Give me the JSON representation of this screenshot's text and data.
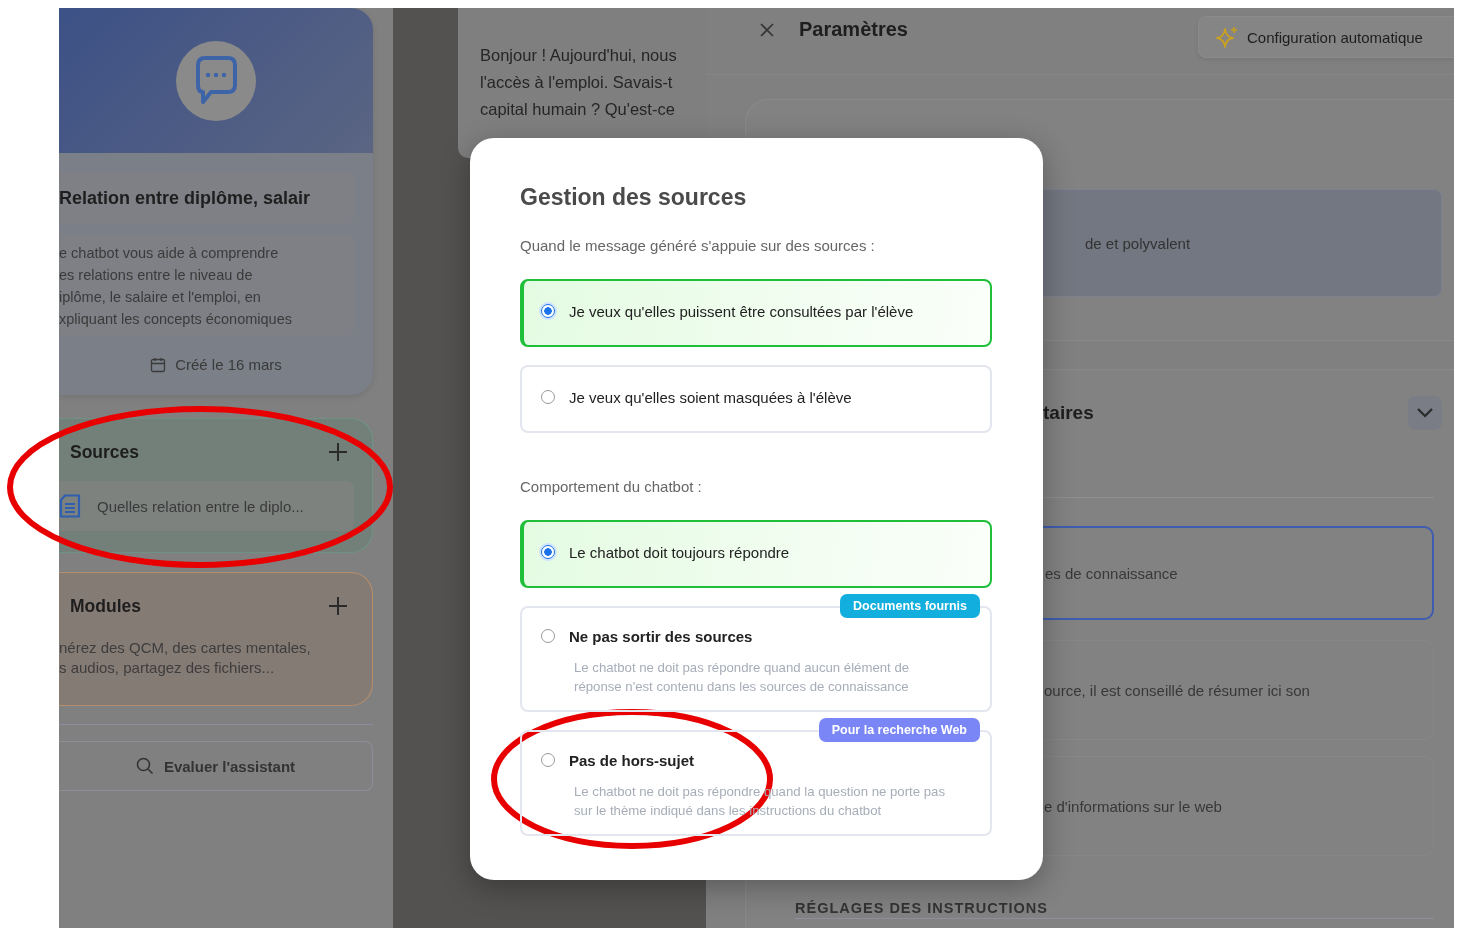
{
  "sidebar": {
    "assistant_card": {
      "title": "Relation entre diplôme, salair",
      "description_lines": [
        "e chatbot vous aide à comprendre",
        "es relations entre le niveau de",
        "iplôme, le salaire et l'emploi, en",
        "xpliquant les concepts économiques"
      ],
      "created": "Créé le 16 mars"
    },
    "sources": {
      "title": "Sources",
      "items": [
        "Quelles relation entre le diplo..."
      ]
    },
    "modules": {
      "title": "Modules",
      "description_lines": [
        "nérez des QCM, des cartes mentales,",
        "s audios, partagez des fichiers..."
      ]
    },
    "evaluate_button": "Evaluer l'assistant"
  },
  "chat": {
    "message_lines": [
      "Bonjour ! Aujourd'hui, nous",
      "l'accès à l'emploi. Savais-t",
      "capital humain ? Qu'est-ce"
    ]
  },
  "settings": {
    "title": "Paramètres",
    "auto_config_button": "Configuration automatique",
    "model_option": "de et polyvalent",
    "section_title": "taires",
    "items": [
      {
        "text": "es de connaissance",
        "selected": true
      },
      {
        "text": "ource, il est conseillé de résumer ici son",
        "selected": false
      },
      {
        "text": "e d'informations sur le web",
        "selected": false
      }
    ],
    "footer_heading": "RÉGLAGES DES INSTRUCTIONS"
  },
  "modal": {
    "title": "Gestion des sources",
    "groups": [
      {
        "label": "Quand le message généré s'appuie sur des sources :",
        "options": [
          {
            "label": "Je veux qu'elles puissent être consultées par l'élève",
            "selected": true
          },
          {
            "label": "Je veux qu'elles soient masquées à l'élève",
            "selected": false
          }
        ]
      },
      {
        "label": "Comportement du chatbot :",
        "options": [
          {
            "label": "Le chatbot doit toujours répondre",
            "selected": true
          },
          {
            "label": "Ne pas sortir des sources",
            "description": "Le chatbot ne doit pas répondre quand aucun élément de réponse n'est contenu dans les sources de connaissance",
            "badge": "Documents fournis",
            "color": "#12aedd",
            "selected": false
          },
          {
            "label": "Pas de hors-sujet",
            "description": "Le chatbot ne doit pas répondre quand la question ne porte pas sur le thème indiqué dans les instructions du chatbot",
            "badge": "Pour la recherche Web",
            "color": "#7a86f6",
            "selected": false
          }
        ]
      }
    ]
  }
}
